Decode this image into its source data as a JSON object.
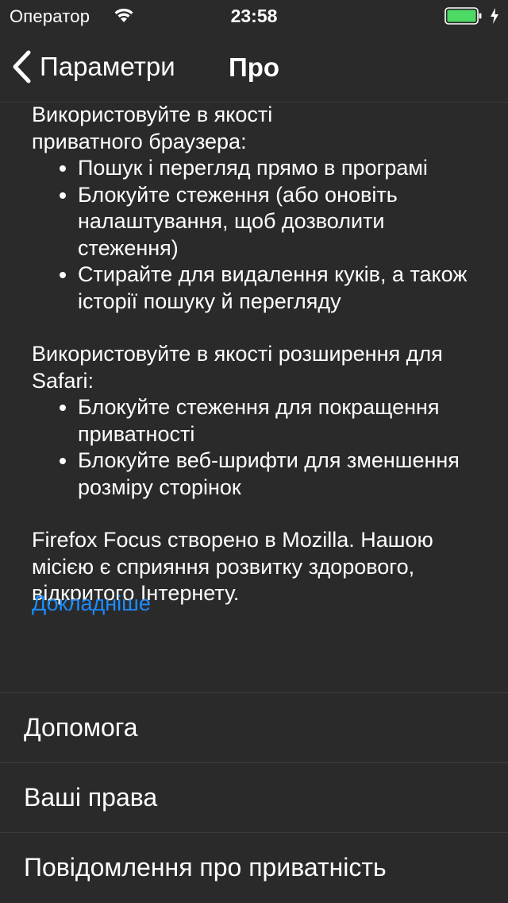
{
  "status": {
    "carrier": "Оператор",
    "time": "23:58",
    "battery_color": "#4cd964"
  },
  "nav": {
    "back_label": "Параметри",
    "title": "Про"
  },
  "content": {
    "browser_intro": "Використовуйте в якості приватного браузера:",
    "browser_bullets": [
      "Пошук і перегляд прямо в програмі",
      "Блокуйте стеження (або оновіть налаштування, щоб дозволити стеження)",
      "Стирайте для видалення куків, а також історії пошуку й перегляду"
    ],
    "safari_intro": "Використовуйте в якості розширення для Safari:",
    "safari_bullets": [
      "Блокуйте стеження для покращення приватності",
      "Блокуйте веб-шрифти для зменшення розміру сторінок"
    ],
    "mission": "Firefox Focus створено в Mozilla. Нашою місією є сприяння розвитку здорового, відкритого Інтернету.",
    "learn_more": "Докладніше",
    "link_color": "#1a8cff"
  },
  "menu": {
    "items": [
      {
        "label": "Допомога"
      },
      {
        "label": "Ваші права"
      },
      {
        "label": "Повідомлення про приватність"
      }
    ]
  }
}
